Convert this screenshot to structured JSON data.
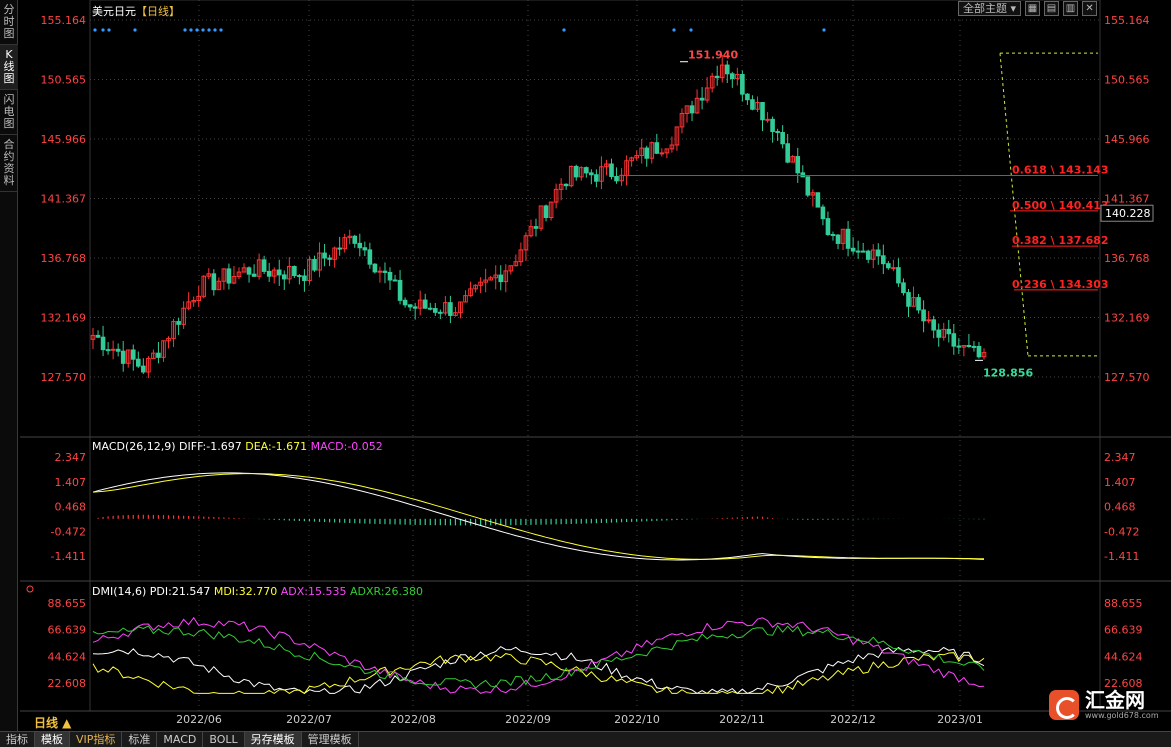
{
  "sidebar": {
    "tabs": [
      "分时图",
      "K线图",
      "闪电图",
      "合约资料"
    ],
    "active_index": 1
  },
  "header": {
    "symbol": "美元日元",
    "period": "【日线】"
  },
  "toolbar": {
    "theme_select": "全部主题",
    "buttons": [
      "▦",
      "▤",
      "▥",
      "✕"
    ]
  },
  "price_axis": {
    "labels": [
      "155.164",
      "150.565",
      "145.966",
      "141.367",
      "136.768",
      "132.169",
      "127.570"
    ]
  },
  "current_price": "140.228",
  "annotations": {
    "high": "151.940",
    "low": "128.856"
  },
  "fib_levels": [
    {
      "label": "0.618 \\ 143.143",
      "value": 143.143
    },
    {
      "label": "0.500 \\ 140.413",
      "value": 140.413
    },
    {
      "label": "0.382 \\ 137.682",
      "value": 137.682
    },
    {
      "label": "0.236 \\ 134.303",
      "value": 134.303
    }
  ],
  "date_axis": {
    "labels": [
      "2022/06",
      "2022/07",
      "2022/08",
      "2022/09",
      "2022/10",
      "2022/11",
      "2022/12",
      "2023/01"
    ]
  },
  "macd": {
    "title": "MACD(26,12,9)",
    "diff": "DIFF:-1.697",
    "dea": "DEA:-1.671",
    "macd": "MACD:-0.052",
    "axis_labels": [
      "2.347",
      "1.407",
      "0.468",
      "-0.472",
      "-1.411"
    ]
  },
  "dmi": {
    "title": "DMI(14,6)",
    "pdi": "PDI:21.547",
    "mdi": "MDI:32.770",
    "adx": "ADX:15.535",
    "adxr": "ADXR:26.380",
    "axis_labels": [
      "88.655",
      "66.639",
      "44.624",
      "22.608"
    ]
  },
  "colors": {
    "up": "#ff3333",
    "down": "#33cc99",
    "diff": "#ffffff",
    "dea": "#ffff33",
    "macd_label": "#ff44ff",
    "adx": "#ff44ff",
    "adxr": "#33cc33",
    "axis_text": "#ff4444",
    "fib": "#ff2222",
    "guide": "#ccee33",
    "grid": "#444444"
  },
  "period_label": "日线 ▲",
  "bottom_tabs": [
    "指标",
    "模板",
    "VIP指标",
    "标准",
    "MACD",
    "BOLL",
    "另存模板",
    "管理模板"
  ],
  "bottom_active": [
    1,
    6
  ],
  "logo": {
    "text": "汇金网",
    "url": "www.gold678.com"
  },
  "chart_data": {
    "type": "candlestick",
    "title": "美元日元【日线】",
    "ylim": [
      127.57,
      155.164
    ],
    "x": [
      "2022/06",
      "2022/07",
      "2022/08",
      "2022/09",
      "2022/10",
      "2022/11",
      "2022/12",
      "2023/01"
    ],
    "close_path": [
      [
        "2022/05-end",
        130.8
      ],
      [
        "2022/06-a",
        128.2
      ],
      [
        "2022/06-b",
        134.5
      ],
      [
        "2022/06-c",
        135.9
      ],
      [
        "2022/07-a",
        135.6
      ],
      [
        "2022/07-b",
        138.5
      ],
      [
        "2022/07-c",
        133.0
      ],
      [
        "2022/08-a",
        132.9
      ],
      [
        "2022/08-b",
        136.5
      ],
      [
        "2022/09-a",
        143.0
      ],
      [
        "2022/09-b",
        143.5
      ],
      [
        "2022/10-a",
        146.0
      ],
      [
        "2022/10-b",
        151.94
      ],
      [
        "2022/11-a",
        147.0
      ],
      [
        "2022/11-b",
        139.0
      ],
      [
        "2022/12-a",
        137.0
      ],
      [
        "2022/12-b",
        131.0
      ],
      [
        "2023/01-a",
        128.856
      ]
    ],
    "high": 151.94,
    "low": 128.856,
    "last": 140.228,
    "fibonacci": [
      143.143,
      140.413,
      137.682,
      134.303
    ]
  }
}
